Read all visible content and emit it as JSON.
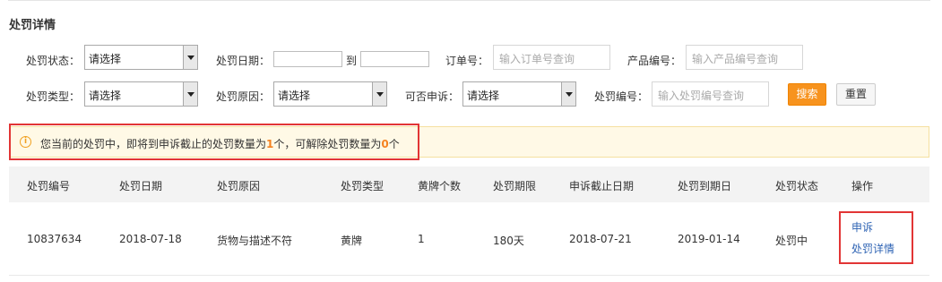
{
  "page_title": "处罚详情",
  "filters": {
    "status_label": "处罚状态：",
    "status_value": "请选择",
    "date_label": "处罚日期：",
    "date_to": "到",
    "order_label": "订单号：",
    "order_placeholder": "输入订单号查询",
    "product_label": "产品编号：",
    "product_placeholder": "输入产品编号查询",
    "type_label": "处罚类型：",
    "type_value": "请选择",
    "reason_label": "处罚原因：",
    "reason_value": "请选择",
    "appeal_label": "可否申诉：",
    "appeal_value": "请选择",
    "penalty_no_label": "处罚编号：",
    "penalty_no_placeholder": "输入处罚编号查询",
    "search_button": "搜索",
    "reset_button": "重置"
  },
  "notice": {
    "icon": "info-icon",
    "prefix": "您当前的处罚中，即将到申诉截止的处罚数量为",
    "count_expiring": "1",
    "middle": "个，可解除处罚数量为",
    "count_removable": "0",
    "suffix": "个"
  },
  "table": {
    "headers": [
      "处罚编号",
      "处罚日期",
      "处罚原因",
      "处罚类型",
      "黄牌个数",
      "处罚期限",
      "申诉截止日期",
      "处罚到期日",
      "处罚状态",
      "操作"
    ],
    "rows": [
      {
        "penalty_no": "10837634",
        "date": "2018-07-18",
        "reason": "货物与描述不符",
        "type": "黄牌",
        "yellow_cards": "1",
        "period": "180天",
        "appeal_deadline": "2018-07-21",
        "expiry": "2019-01-14",
        "status": "处罚中",
        "actions": [
          "申诉",
          "处罚详情"
        ]
      }
    ]
  },
  "colors": {
    "accent": "#f7931e",
    "link": "#2f64b4",
    "highlight_box": "#e23535",
    "notice_bg": "#fff9e6"
  }
}
